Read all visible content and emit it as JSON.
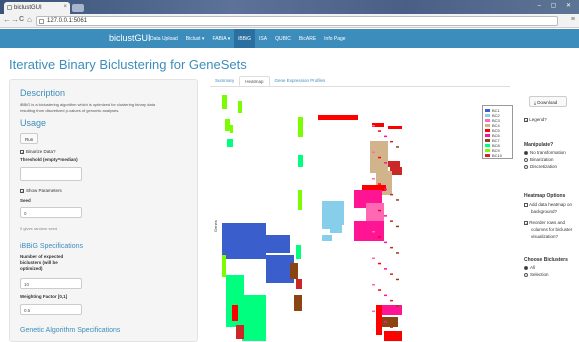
{
  "browser": {
    "tab_title": "biclustGUI",
    "tab_close": "×",
    "window_controls": "– ▢ ✕",
    "url": "127.0.0.1:5061",
    "back": "←",
    "forward": "→",
    "reload": "C",
    "home": "⌂",
    "menu": "≡"
  },
  "navbar": {
    "brand": "biclustGUI",
    "items": [
      {
        "label": "Data Upload",
        "active": false
      },
      {
        "label": "Biclust ▾",
        "active": false
      },
      {
        "label": "FABIA ▾",
        "active": false
      },
      {
        "label": "iBBiG",
        "active": true
      },
      {
        "label": "ISA",
        "active": false
      },
      {
        "label": "QUBIC",
        "active": false
      },
      {
        "label": "BicARE",
        "active": false
      },
      {
        "label": "Info Page",
        "active": false
      }
    ]
  },
  "page_title": "Iterative Binary Biclustering for GeneSets",
  "sidebar": {
    "description_heading": "Description",
    "description_text_1": "iBBiG is a biclustering algorithm which is optimized for clustering binary data",
    "description_text_2": "resulting from discretized p-values of genomic analyses.",
    "usage_heading": "Usage",
    "run_label": "Run",
    "binarize_label": "Binarize Data?",
    "binarize_checked": true,
    "threshold_label": "Threshold (empty=median)",
    "threshold_value": "",
    "show_params_label": "Show Parameters",
    "show_params_checked": true,
    "seed_label": "Seed",
    "seed_value": "0",
    "seed_help": "0 gives random seed",
    "ibbig_spec_heading": "iBBiG Specifications",
    "n_bicluster_label_1": "Number of expected",
    "n_bicluster_label_2": "biclusters (will be",
    "n_bicluster_label_3": "optimized)",
    "n_bicluster_value": "10",
    "weighting_label": "Weighting Factor [0,1]",
    "weighting_value": "0.5",
    "genetic_heading": "Genetic Algorithm Specifications"
  },
  "tabs": [
    {
      "label": "Summary",
      "active": false
    },
    {
      "label": "Heatmap",
      "active": true
    },
    {
      "label": "Gene Expression Profiles",
      "active": false
    }
  ],
  "heatmap": {
    "y_axis_label": "Genes",
    "legend": [
      "BC1",
      "BC2",
      "BC3",
      "BC4",
      "BC5",
      "BC6",
      "BC7",
      "BC8",
      "BC9",
      "BC10"
    ],
    "legend_colors": [
      "#3a5fcd",
      "#87ceeb",
      "#ff69b4",
      "#d2b48c",
      "#ff0000",
      "#ff1493",
      "#8b4513",
      "#00ff7f",
      "#7cfc00",
      "#cd2626"
    ]
  },
  "right_panel": {
    "download_label": "Download",
    "download_icon": "⤓",
    "legend_label": "Legend?",
    "legend_checked": true,
    "manipulate_heading": "Manipulate?",
    "manipulate_options": [
      {
        "label": "No transformation",
        "selected": true
      },
      {
        "label": "Binarization",
        "selected": false
      },
      {
        "label": "Discretization",
        "selected": false
      }
    ],
    "heatmap_options_heading": "Heatmap Options",
    "add_data_label_1": "Add data heatmap on",
    "add_data_label_2": "background?",
    "add_data_checked": false,
    "reorder_label_1": "Reorder rows and",
    "reorder_label_2": "columns for bicluster",
    "reorder_label_3": "visualization?",
    "reorder_checked": true,
    "choose_heading": "Choose Biclusters",
    "choose_options": [
      {
        "label": "All",
        "selected": true
      },
      {
        "label": "Selection",
        "selected": false
      }
    ]
  }
}
